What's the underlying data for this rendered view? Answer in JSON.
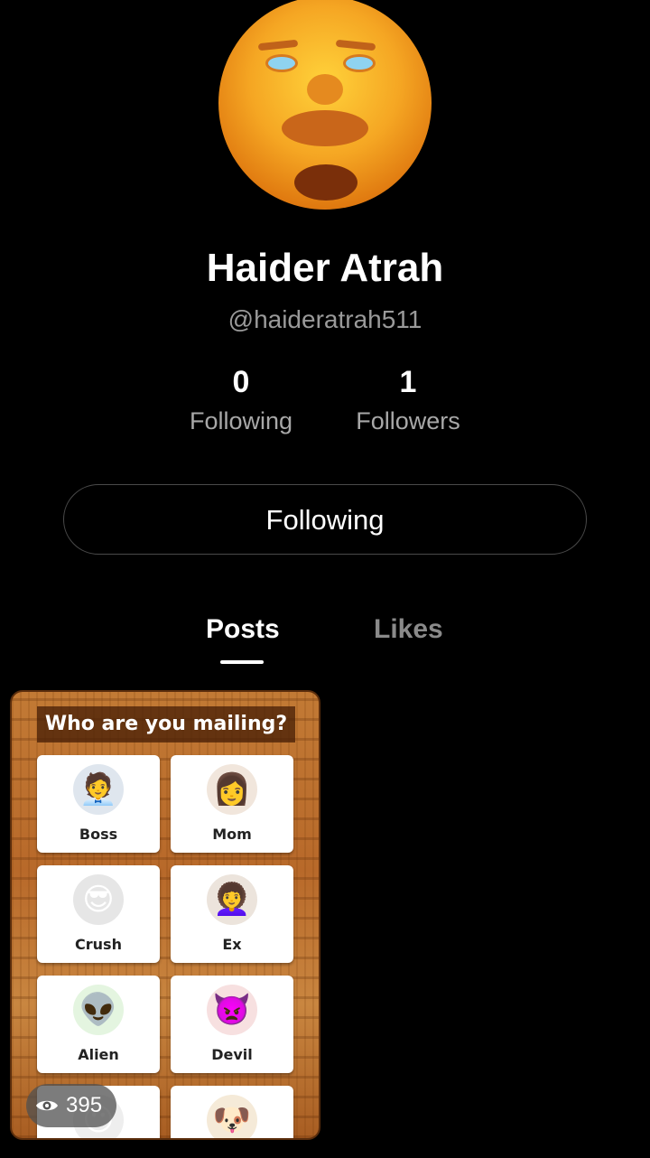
{
  "profile": {
    "name": "Haider Atrah",
    "handle": "@haideratrah511"
  },
  "stats": {
    "following_count": "0",
    "following_label": "Following",
    "followers_count": "1",
    "followers_label": "Followers"
  },
  "follow_button": {
    "label": "Following"
  },
  "tabs": [
    {
      "label": "Posts",
      "active": true
    },
    {
      "label": "Likes",
      "active": false
    }
  ],
  "post": {
    "title": "Who are you mailing?",
    "options": [
      {
        "label": "Boss",
        "icon": "man-in-suit-reading-icon"
      },
      {
        "label": "Mom",
        "icon": "woman-reading-letter-icon"
      },
      {
        "label": "Crush",
        "icon": "guy-with-sunglasses-icon"
      },
      {
        "label": "Ex",
        "icon": "woman-with-letter-icon"
      },
      {
        "label": "Alien",
        "icon": "green-alien-icon"
      },
      {
        "label": "Devil",
        "icon": "red-devil-icon"
      },
      {
        "label": "",
        "icon": "cartoon-face-icon"
      },
      {
        "label": "",
        "icon": "dog-icon"
      }
    ],
    "views": "395"
  }
}
